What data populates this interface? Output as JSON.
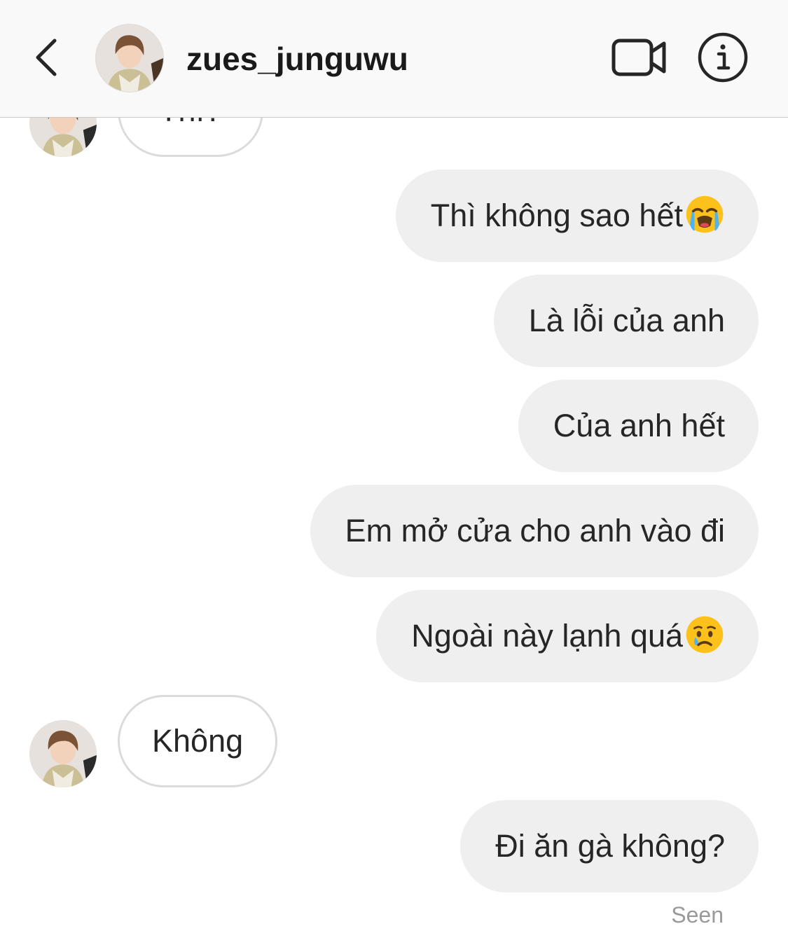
{
  "header": {
    "username": "zues_junguwu"
  },
  "messages": [
    {
      "from": "other",
      "text": "Thì?",
      "partially_hidden": true
    },
    {
      "from": "me",
      "text": "Thì không sao hết",
      "emoji": "loudly-crying-face"
    },
    {
      "from": "me",
      "text": "Là lỗi của anh"
    },
    {
      "from": "me",
      "text": "Của anh hết"
    },
    {
      "from": "me",
      "text": "Em mở cửa cho anh vào đi"
    },
    {
      "from": "me",
      "text": "Ngoài này lạnh quá",
      "emoji": "crying-face"
    },
    {
      "from": "other",
      "text": "Không"
    },
    {
      "from": "me",
      "text": "Đi ăn gà không?"
    }
  ],
  "status": {
    "seen": "Seen"
  },
  "icons": {
    "back": "chevron-left-icon",
    "video_call": "video-camera-icon",
    "info": "info-icon"
  },
  "colors": {
    "header_bg": "#f9f9f9",
    "sent_bubble_bg": "#efefef",
    "received_bubble_border": "#dbdbdb",
    "text": "#262626",
    "seen_text": "#9a9a9a"
  }
}
